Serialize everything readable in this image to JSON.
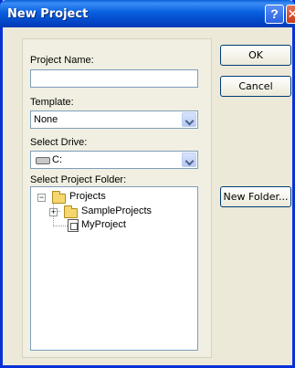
{
  "window": {
    "title": "New Project",
    "help_label": "?",
    "close_label": "✕"
  },
  "form": {
    "project_name_label": "Project Name:",
    "project_name_value": "",
    "template_label": "Template:",
    "template_value": "None",
    "drive_label": "Select Drive:",
    "drive_value": "C:",
    "folder_label": "Select Project Folder:"
  },
  "tree": {
    "root": {
      "label": "Projects",
      "expander": "−"
    },
    "items": [
      {
        "label": "SampleProjects",
        "expander": "+"
      },
      {
        "label": "MyProject"
      }
    ]
  },
  "buttons": {
    "ok": "OK",
    "cancel": "Cancel",
    "new_folder": "New Folder..."
  }
}
